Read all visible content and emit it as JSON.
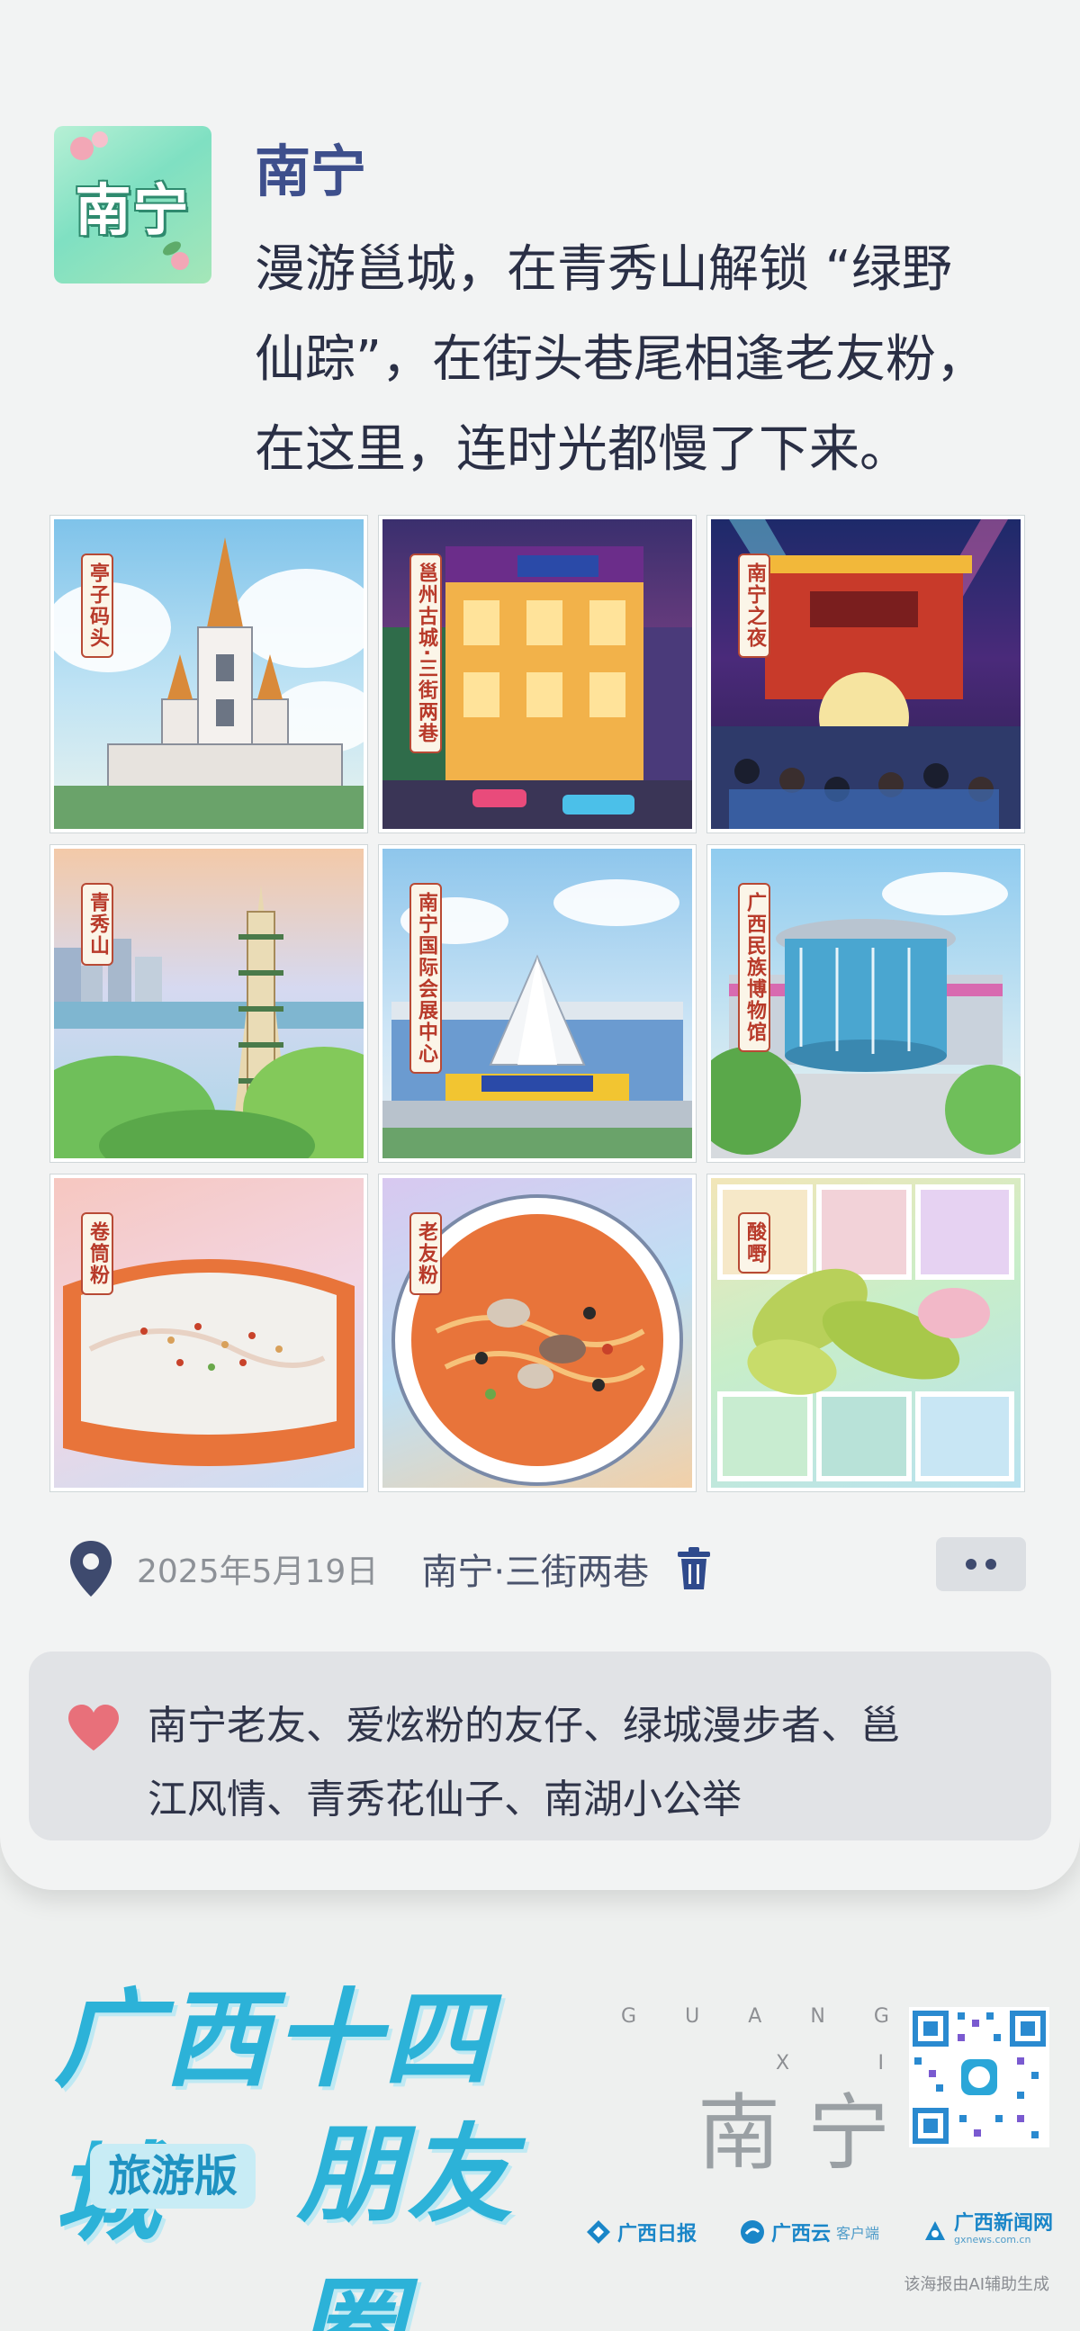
{
  "post": {
    "avatar_text": "南宁",
    "author": "南宁",
    "text_lines": [
      "漫游邕城，在青秀山解锁 “绿野",
      "仙踪”，在街头巷尾相逢老友粉，",
      "在这里，连时光都慢了下来。"
    ]
  },
  "photos": [
    {
      "label": "亭子码头",
      "icon": "church-tower-illustration"
    },
    {
      "label": "邕州古城·三街两巷",
      "icon": "old-street-night-illustration"
    },
    {
      "label": "南宁之夜",
      "icon": "night-gate-crowd-illustration"
    },
    {
      "label": "青秀山",
      "icon": "pagoda-illustration"
    },
    {
      "label": "南宁国际会展中心",
      "icon": "expo-center-illustration"
    },
    {
      "label": "广西民族博物馆",
      "icon": "museum-illustration"
    },
    {
      "label": "卷筒粉",
      "icon": "rice-roll-illustration"
    },
    {
      "label": "老友粉",
      "icon": "noodle-bowl-illustration"
    },
    {
      "label": "酸嘢",
      "icon": "pickled-fruit-illustration"
    }
  ],
  "meta": {
    "date": "2025年5月19日",
    "location": "南宁·三街两巷",
    "icons": [
      "location-pin-icon",
      "trash-icon",
      "more-icon"
    ]
  },
  "likes": {
    "icon": "heart-icon",
    "text_lines": [
      "南宁老友、爱炫粉的友仔、绿城漫步者、邕",
      "江风情、青秀花仙子、南湖小公举"
    ]
  },
  "footer": {
    "brand_line1": "广西十四城",
    "brand_badge": "旅游版",
    "brand_line2": "朋友圈",
    "guangxi_letters": [
      "G",
      "U",
      "A",
      "N",
      "G"
    ],
    "xi_letters": [
      "X",
      "I"
    ],
    "city": "南宁",
    "partners": [
      {
        "name": "广西日报",
        "suffix": ""
      },
      {
        "name": "广西云",
        "suffix": "客户端"
      },
      {
        "name": "广西新闻网",
        "suffix": "gxnews.com.cn"
      }
    ],
    "ai_note": "该海报由AI辅助生成"
  },
  "colors": {
    "accent": "#3e4f8c",
    "brand": "#2cb2d8",
    "heart": "#e8707a",
    "label_red": "#b83a2a"
  }
}
